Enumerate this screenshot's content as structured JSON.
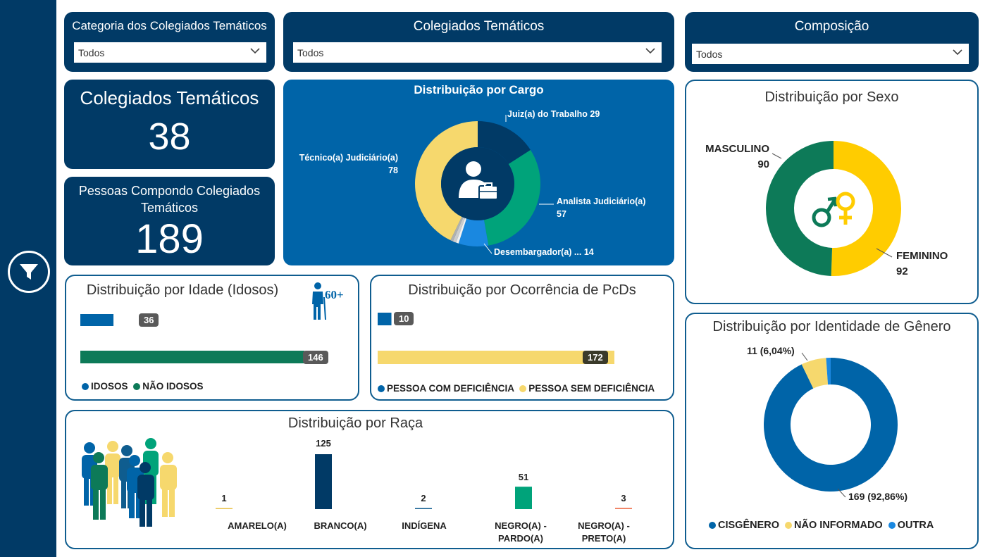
{
  "sidebar": {
    "filter_icon": "filter-icon"
  },
  "slicers": {
    "categoria": {
      "title": "Categoria dos Colegiados Temáticos",
      "value": "Todos"
    },
    "colegiados": {
      "title": "Colegiados Temáticos",
      "value": "Todos"
    },
    "composicao": {
      "title": "Composição",
      "value": "Todos"
    }
  },
  "kpis": {
    "colegiados": {
      "label": "Colegiados Temáticos",
      "value": "38"
    },
    "pessoas": {
      "label": "Pessoas Compondo Colegiados Temáticos",
      "value": "189"
    }
  },
  "cargo": {
    "title": "Distribuição por Cargo",
    "icon": "employee-briefcase-icon",
    "labels": [
      {
        "name": "Juiz(a) do Trabalho",
        "value": "29"
      },
      {
        "name": "Analista Judiciário(a)",
        "value": "57"
      },
      {
        "name": "Desembargador(a) ...",
        "value": "14"
      },
      {
        "name": "Técnico(a) Judiciário(a)",
        "value": "78"
      }
    ],
    "slice_colors": [
      "#013a66",
      "#00a37a",
      "#1a88e0",
      "#f2f2f2",
      "#cccccc",
      "#b0b0b0",
      "#f6d86d"
    ]
  },
  "sexo": {
    "title": "Distribuição por Sexo",
    "icon": "gender-symbols-icon",
    "masculino": {
      "label": "MASCULINO",
      "value": "90",
      "color": "#0d7a58"
    },
    "feminino": {
      "label": "FEMININO",
      "value": "92",
      "color": "#ffcc00"
    }
  },
  "idade": {
    "title": "Distribuição por Idade (Idosos)",
    "icon": "elderly-60plus-icon",
    "legend": [
      "IDOSOS",
      "NÃO IDOSOS"
    ],
    "colors": [
      "#0064a8",
      "#0d7a58"
    ]
  },
  "pcd": {
    "title": "Distribuição por Ocorrência de PcDs",
    "legend": [
      "PESSOA COM DEFICIÊNCIA",
      "PESSOA SEM DEFICIÊNCIA"
    ],
    "colors": [
      "#0064a8",
      "#f6d86d"
    ]
  },
  "raca": {
    "title": "Distribuição por Raça",
    "icon": "people-group-icon"
  },
  "genero": {
    "title": "Distribuição por Identidade de Gênero",
    "label_small": "11 (6,04%)",
    "label_large": "169 (92,86%)",
    "legend": [
      "CISGÊNERO",
      "NÃO INFORMADO",
      "OUTRA"
    ],
    "colors": [
      "#0064a8",
      "#f6d86d",
      "#1a88e0"
    ]
  },
  "chart_data": [
    {
      "type": "pie",
      "title": "Distribuição por Cargo",
      "categories": [
        "Juiz(a) do Trabalho",
        "Analista Judiciário(a)",
        "Desembargador(a) ...",
        "Técnico(a) Judiciário(a)"
      ],
      "values": [
        29,
        57,
        14,
        78
      ]
    },
    {
      "type": "pie",
      "title": "Distribuição por Sexo",
      "categories": [
        "MASCULINO",
        "FEMININO"
      ],
      "values": [
        90,
        92
      ]
    },
    {
      "type": "bar",
      "title": "Distribuição por Idade (Idosos)",
      "categories": [
        "IDOSOS",
        "NÃO IDOSOS"
      ],
      "values": [
        36,
        146
      ],
      "orientation": "horizontal"
    },
    {
      "type": "bar",
      "title": "Distribuição por Ocorrência de PcDs",
      "categories": [
        "PESSOA COM DEFICIÊNCIA",
        "PESSOA SEM DEFICIÊNCIA"
      ],
      "values": [
        10,
        172
      ],
      "orientation": "horizontal"
    },
    {
      "type": "bar",
      "title": "Distribuição por Raça",
      "categories": [
        "AMARELO(A)",
        "BRANCO(A)",
        "INDÍGENA",
        "NEGRO(A) - PARDO(A)",
        "NEGRO(A) - PRETO(A)"
      ],
      "values": [
        1,
        125,
        2,
        51,
        3
      ],
      "colors": [
        "#e8c24a",
        "#013a66",
        "#0f5d8f",
        "#00a37a",
        "#f08060"
      ]
    },
    {
      "type": "pie",
      "title": "Distribuição por Identidade de Gênero",
      "categories": [
        "CISGÊNERO",
        "NÃO INFORMADO",
        "OUTRA"
      ],
      "values": [
        169,
        11,
        2
      ]
    }
  ]
}
